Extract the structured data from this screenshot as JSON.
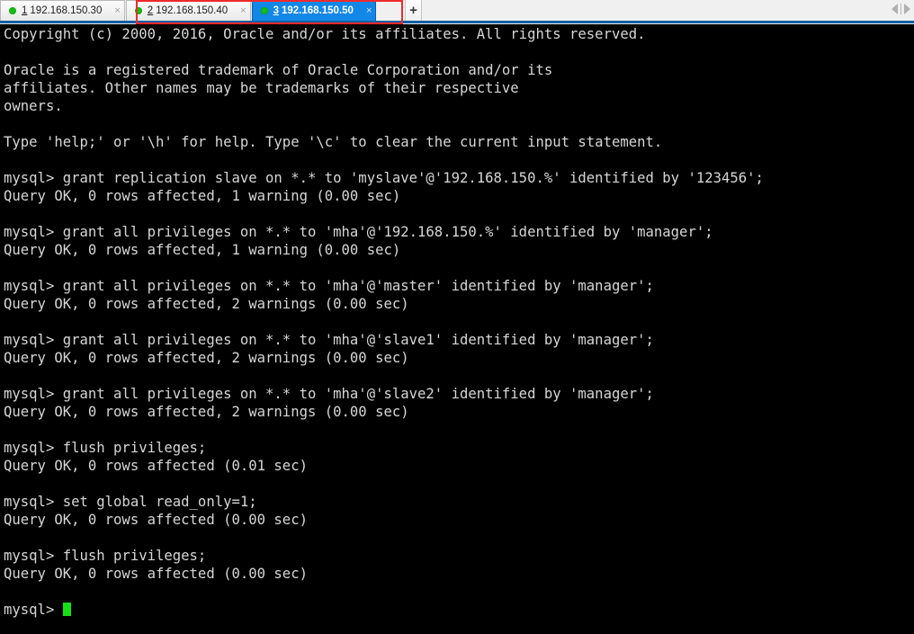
{
  "window": {
    "type": "ssh-terminal-client",
    "accent_blue": "#1287e8",
    "annotation_red": "#ef2a2a",
    "terminal_bg": "#000000",
    "terminal_fg": "#d6d6d6",
    "cursor_color": "#15e015",
    "status_dot_color": "#12bf12"
  },
  "tabbar": {
    "tabs": [
      {
        "num": "1",
        "label": "192.168.150.30",
        "close": "×",
        "active": false,
        "status": "connected"
      },
      {
        "num": "2",
        "label": "192.168.150.40",
        "close": "×",
        "active": false,
        "status": "connected"
      },
      {
        "num": "3",
        "label": "192.168.150.50",
        "close": "×",
        "active": true,
        "status": "connected"
      }
    ],
    "new_tab_label": "+",
    "nav_prev_label": "◀",
    "nav_next_label": "▶"
  },
  "terminal": {
    "prompt": "mysql>",
    "lines": [
      "Copyright (c) 2000, 2016, Oracle and/or its affiliates. All rights reserved.",
      "",
      "Oracle is a registered trademark of Oracle Corporation and/or its",
      "affiliates. Other names may be trademarks of their respective",
      "owners.",
      "",
      "Type 'help;' or '\\h' for help. Type '\\c' to clear the current input statement.",
      "",
      "mysql> grant replication slave on *.* to 'myslave'@'192.168.150.%' identified by '123456';",
      "Query OK, 0 rows affected, 1 warning (0.00 sec)",
      "",
      "mysql> grant all privileges on *.* to 'mha'@'192.168.150.%' identified by 'manager';",
      "Query OK, 0 rows affected, 1 warning (0.00 sec)",
      "",
      "mysql> grant all privileges on *.* to 'mha'@'master' identified by 'manager';",
      "Query OK, 0 rows affected, 2 warnings (0.00 sec)",
      "",
      "mysql> grant all privileges on *.* to 'mha'@'slave1' identified by 'manager';",
      "Query OK, 0 rows affected, 2 warnings (0.00 sec)",
      "",
      "mysql> grant all privileges on *.* to 'mha'@'slave2' identified by 'manager';",
      "Query OK, 0 rows affected, 2 warnings (0.00 sec)",
      "",
      "mysql> flush privileges;",
      "Query OK, 0 rows affected (0.01 sec)",
      "",
      "mysql> set global read_only=1;",
      "Query OK, 0 rows affected (0.00 sec)",
      "",
      "mysql> flush privileges;",
      "Query OK, 0 rows affected (0.00 sec)",
      ""
    ],
    "current_prompt": "mysql> ",
    "cursor": "block"
  }
}
